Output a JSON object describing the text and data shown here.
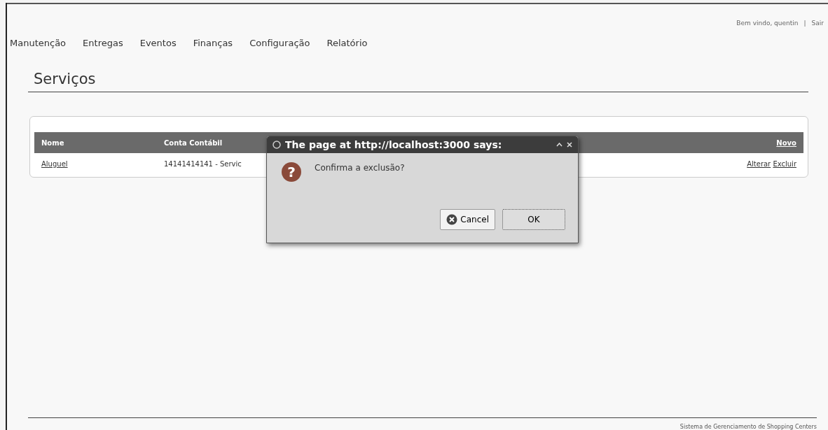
{
  "header": {
    "welcome": "Bem vindo, quentin",
    "separator": "|",
    "logout": "Sair"
  },
  "nav": [
    {
      "label": "Manutenção"
    },
    {
      "label": "Entregas"
    },
    {
      "label": "Eventos"
    },
    {
      "label": "Finanças"
    },
    {
      "label": "Configuração"
    },
    {
      "label": "Relatório"
    }
  ],
  "page_title": "Serviços",
  "table": {
    "columns": [
      "Nome",
      "Conta Contábil"
    ],
    "new_link": "Novo",
    "rows": [
      {
        "cells": [
          "Aluguel",
          "14141414141 - Servic"
        ],
        "actions": [
          "Alterar",
          "Excluir"
        ]
      }
    ]
  },
  "dialog": {
    "title": "The page at http://localhost:3000 says:",
    "icon_glyph": "?",
    "message": "Confirma a exclusão?",
    "buttons": [
      {
        "label": "Cancel",
        "kind": "cancel"
      },
      {
        "label": "OK",
        "kind": "ok"
      }
    ]
  },
  "footer": "Sistema de Gerenciamento de Shopping Centers"
}
